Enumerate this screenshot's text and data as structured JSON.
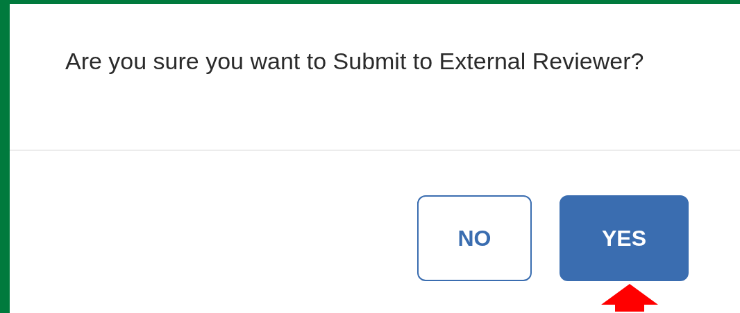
{
  "dialog": {
    "message": "Are you sure you want to Submit to External Reviewer?",
    "buttons": [
      {
        "label": "NO",
        "kind": "secondary"
      },
      {
        "label": "YES",
        "kind": "primary"
      }
    ]
  }
}
